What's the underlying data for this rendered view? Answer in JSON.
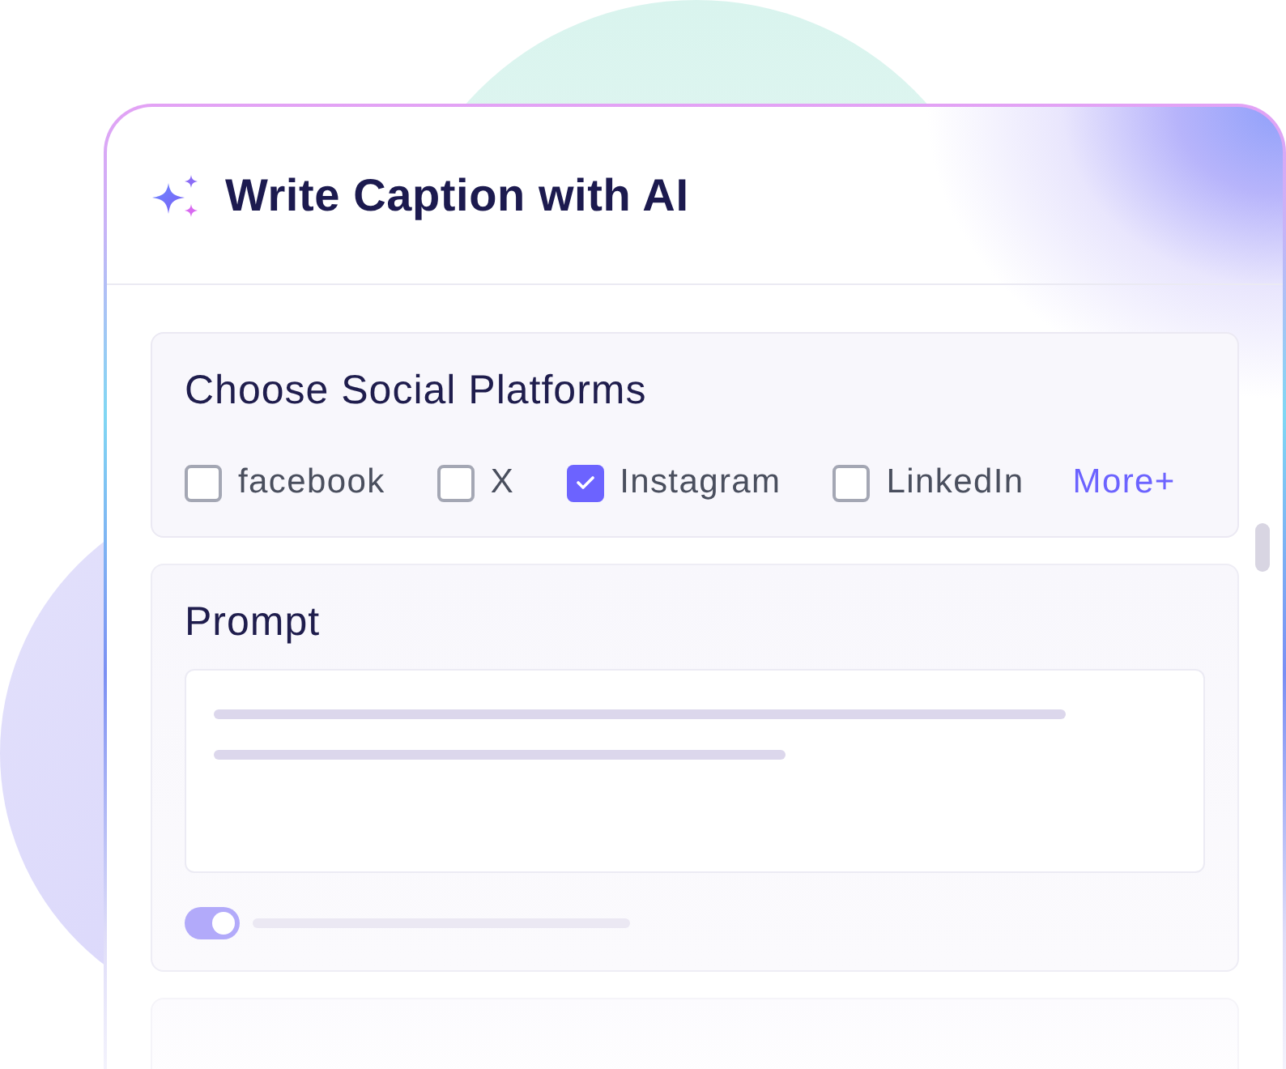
{
  "window": {
    "title": "Write Caption with AI"
  },
  "platforms": {
    "title": "Choose Social Platforms",
    "options": [
      {
        "label": "facebook",
        "checked": false
      },
      {
        "label": "X",
        "checked": false
      },
      {
        "label": "Instagram",
        "checked": true
      },
      {
        "label": "LinkedIn",
        "checked": false
      }
    ],
    "more_link": "More+"
  },
  "prompt": {
    "title": "Prompt",
    "toggle": {
      "on": true
    }
  }
}
